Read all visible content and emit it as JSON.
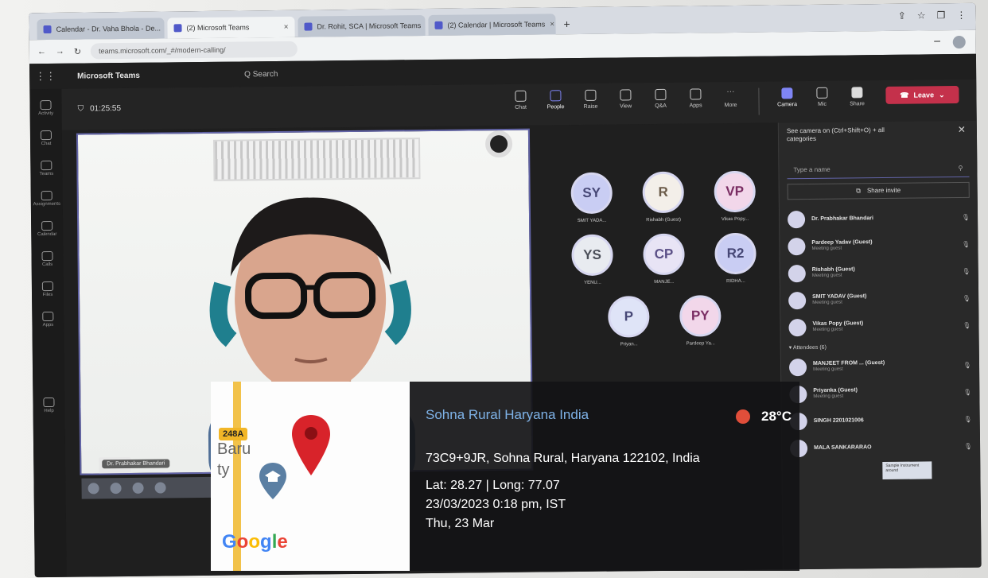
{
  "browser": {
    "tabs": [
      {
        "label": "Calendar - Dr. Vaha Bhola - De...",
        "active": false
      },
      {
        "label": "(2) Microsoft Teams",
        "active": true
      },
      {
        "label": "Dr. Rohit, SCA | Microsoft Teams",
        "active": false
      },
      {
        "label": "(2) Calendar | Microsoft Teams",
        "active": false
      }
    ],
    "new_tab": "+",
    "url": "teams.microsoft.com/_#/modern-calling/"
  },
  "teams": {
    "app_name": "Microsoft Teams",
    "search_label": "Q  Search",
    "rail": [
      "Activity",
      "Chat",
      "Teams",
      "Assignments",
      "Calendar",
      "Calls",
      "Files",
      "Apps",
      "Help"
    ],
    "timer": "01:25:55",
    "controls": [
      "Chat",
      "People",
      "Raise",
      "View",
      "Q&A",
      "Apps",
      "More",
      "Camera",
      "Mic",
      "Share"
    ],
    "leave_label": "Leave",
    "video_name": "Dr. Prabhakar Bhandari"
  },
  "avatars": [
    {
      "initials": "SY",
      "label": "SMIT YADA...",
      "color": "#c9cdf3",
      "text": "#464775"
    },
    {
      "initials": "R",
      "label": "Rishabh (Guest)",
      "color": "#f3efe9",
      "text": "#6a5a48"
    },
    {
      "initials": "VP",
      "label": "Vikas Popy...",
      "color": "#f2d7ea",
      "text": "#7a2d63"
    },
    {
      "initials": "YS",
      "label": "YENU...",
      "color": "#e8ebf0",
      "text": "#4a4e58"
    },
    {
      "initials": "CP",
      "label": "MANJE...",
      "color": "#e8e4f5",
      "text": "#5a4f86"
    },
    {
      "initials": "R2",
      "label": "RIDHA...",
      "color": "#c9cdf3",
      "text": "#464775"
    },
    {
      "initials": "P",
      "label": "Priyan...",
      "color": "#dfe4f7",
      "text": "#464775"
    },
    {
      "initials": "PY",
      "label": "Pardeep Ya...",
      "color": "#f2d7ea",
      "text": "#7a2d63"
    }
  ],
  "panel": {
    "title": "See camera on (Ctrl+Shift+O) + all categories",
    "close": "✕",
    "search_placeholder": "Type a name",
    "invite_label": "Share invite",
    "in_meeting": [
      {
        "name": "Dr. Prabhakar Bhandari",
        "sub": ""
      },
      {
        "name": "Pardeep Yadav (Guest)",
        "sub": "Meeting guest"
      },
      {
        "name": "Rishabh (Guest)",
        "sub": "Meeting guest"
      },
      {
        "name": "SMIT YADAV (Guest)",
        "sub": "Meeting guest"
      },
      {
        "name": "Vikas Popy (Guest)",
        "sub": "Meeting guest"
      }
    ],
    "attendees_label": "Attendees (6)",
    "attendees": [
      {
        "name": "MANJEET FROM ... (Guest)",
        "sub": "Meeting guest"
      },
      {
        "name": "Priyanka (Guest)",
        "sub": "Meeting guest"
      },
      {
        "name": "SINGH 2201021006",
        "sub": ""
      },
      {
        "name": "MALA SANKARARAO",
        "sub": ""
      }
    ],
    "tooltip": "Sample Instrument around"
  },
  "geo": {
    "road_tag": "248A",
    "map_text_1": "Baru",
    "map_text_2": "ty",
    "google": "Google",
    "place": "Sohna Rural Haryana India",
    "temperature": "28°C",
    "address": "73C9+9JR, Sohna Rural, Haryana 122102, India",
    "latlong": "Lat: 28.27 | Long: 77.07",
    "datetime": "23/03/2023  0:18 pm, IST",
    "day": "Thu, 23 Mar",
    "colors": {
      "pin": "#d8232a",
      "temp_dot": "#e04e3a",
      "place": "#7fb3e8"
    }
  }
}
